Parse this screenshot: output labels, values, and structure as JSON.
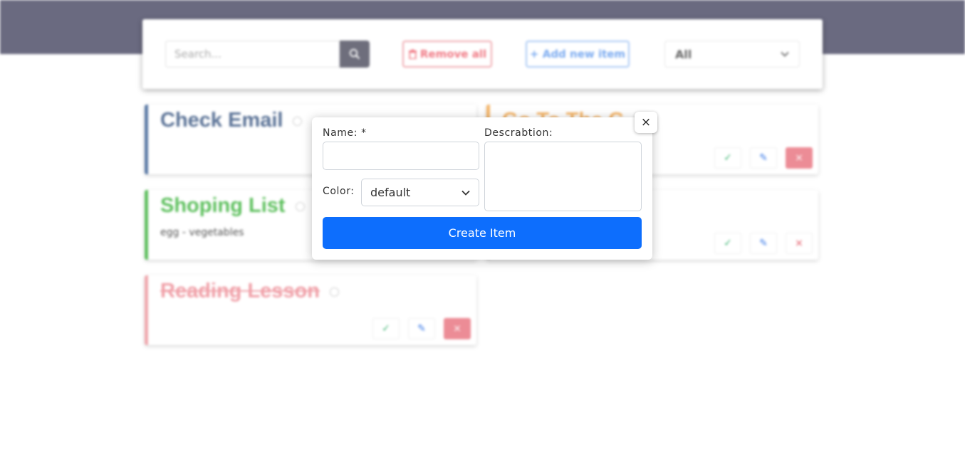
{
  "toolbar": {
    "search_placeholder": "Search...",
    "remove_all_label": "Remove all",
    "add_new_label": "+ Add new item",
    "filter_value": "All"
  },
  "cards": [
    {
      "title": "Check Email",
      "description": "",
      "color": "#5b7aa6",
      "title_color": "#5a7296"
    },
    {
      "title": "Go To The G",
      "description": "",
      "color": "#f5b66a",
      "title_color": "#f5b66a"
    },
    {
      "title": "Shoping List",
      "description": "egg - vegetables",
      "color": "#5ec05e",
      "title_color": "#5ec05e"
    },
    {
      "title": "Reading Lesson",
      "description": "",
      "color": "#f0a8ae",
      "title_color": "#f0a0a8"
    }
  ],
  "modal": {
    "close_label": "×",
    "name_label": "Name: *",
    "description_label": "Descrabtion:",
    "color_label": "Color:",
    "color_value": "default",
    "submit_label": "Create Item",
    "primary_color": "#0d6efd"
  }
}
